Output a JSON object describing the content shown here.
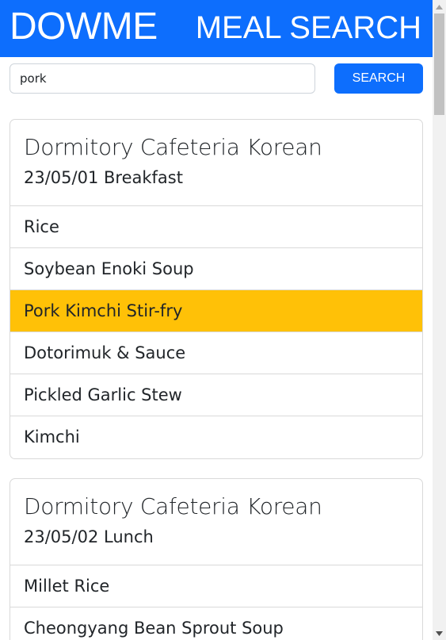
{
  "header": {
    "brand": "DOWME",
    "title": "MEAL SEARCH",
    "background_color": "#0d6efd"
  },
  "search": {
    "value": "pork",
    "button_label": "SEARCH"
  },
  "highlight_color": "#ffc107",
  "results": [
    {
      "title": "Dormitory Cafeteria Korean",
      "subtitle": "23/05/01 Breakfast",
      "items": [
        "Rice",
        "Soybean Enoki Soup",
        "Pork Kimchi Stir-fry",
        "Dotorimuk & Sauce",
        "Pickled Garlic Stew",
        "Kimchi"
      ],
      "highlighted_index": 2
    },
    {
      "title": "Dormitory Cafeteria Korean",
      "subtitle": "23/05/02 Lunch",
      "items": [
        "Millet Rice",
        "Cheongyang Bean Sprout Soup"
      ],
      "highlighted_index": -1
    }
  ],
  "scrollbar": {
    "up_icon": "triangle-up-icon",
    "down_icon": "triangle-down-icon"
  }
}
